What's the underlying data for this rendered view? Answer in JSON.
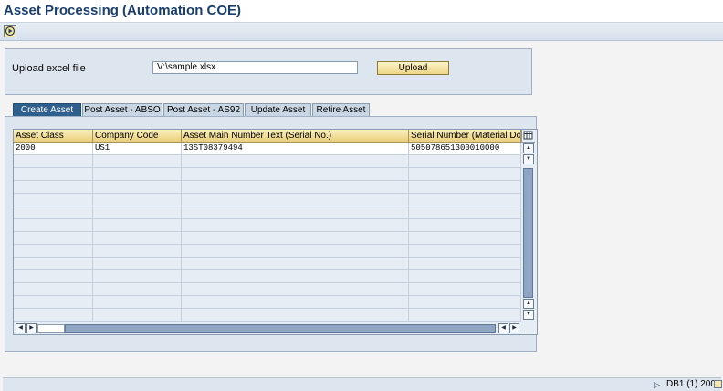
{
  "window": {
    "title": "Asset Processing (Automation COE)"
  },
  "toolbar": {
    "execute_icon": "execute-icon"
  },
  "upload": {
    "label": "Upload excel file",
    "file_value": "V:\\sample.xlsx",
    "button_label": "Upload"
  },
  "tabs": [
    {
      "label": "Create Asset",
      "active": true
    },
    {
      "label": "Post Asset - ABSO",
      "active": false
    },
    {
      "label": "Post Asset - AS92",
      "active": false
    },
    {
      "label": "Update Asset",
      "active": false
    },
    {
      "label": "Retire Asset",
      "active": false
    }
  ],
  "grid": {
    "columns": [
      "Asset Class",
      "Company Code",
      "Asset Main Number Text (Serial No.)",
      "Serial Number (Material Doc)"
    ],
    "rows": [
      [
        "2000",
        "US1",
        "13ST08379494",
        "505078651300010000"
      ]
    ],
    "empty_rows": 13
  },
  "status": {
    "text": "DB1 (1) 200"
  },
  "colors": {
    "title": "#1a3f6e",
    "active_tab": "#2e5f8d",
    "header_fill": "#f3dc94"
  }
}
